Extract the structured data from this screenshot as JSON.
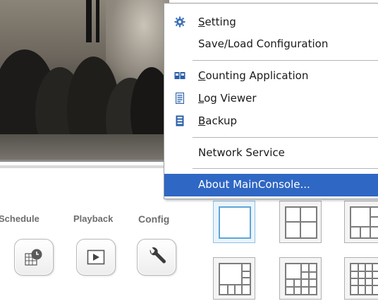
{
  "toolbar": {
    "schedule_label": "Schedule",
    "playback_label": "Playback",
    "config_label": "Config"
  },
  "context_menu": {
    "setting": {
      "mnemonic": "S",
      "rest": "etting"
    },
    "save_load": "Save/Load Configuration",
    "counting": {
      "mnemonic": "C",
      "rest": "ounting Application"
    },
    "log_viewer": {
      "mnemonic": "L",
      "rest": "og Viewer"
    },
    "backup": {
      "mnemonic": "B",
      "rest": "ackup"
    },
    "network_service": "Network Service",
    "about": "About MainConsole..."
  },
  "colors": {
    "menu_highlight": "#2f67c4",
    "selected_split": "#5ea6d8",
    "toolbar_label": "#6e6e6e"
  }
}
